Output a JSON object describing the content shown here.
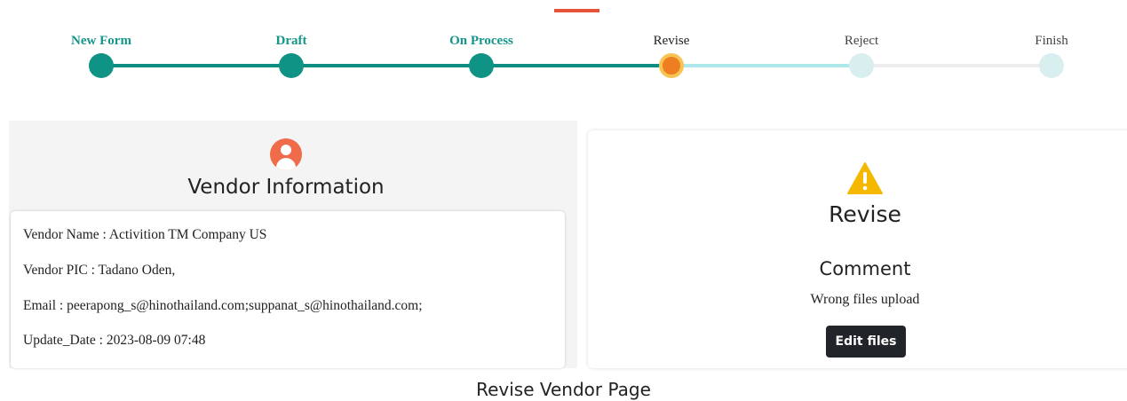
{
  "stepper": {
    "steps": [
      {
        "label": "New Form",
        "state": "done"
      },
      {
        "label": "Draft",
        "state": "done"
      },
      {
        "label": "On Process",
        "state": "done"
      },
      {
        "label": "Revise",
        "state": "current"
      },
      {
        "label": "Reject",
        "state": "todo"
      },
      {
        "label": "Finish",
        "state": "todo"
      }
    ]
  },
  "vendor": {
    "icon": "user-circle-icon",
    "title": "Vendor Information",
    "name_line": "Vendor Name : Activition TM Company US",
    "pic_line": "Vendor PIC : Tadano Oden,",
    "email_line": "Email : peerapong_s@hinothailand.com;suppanat_s@hinothailand.com;",
    "update_line": "Update_Date : 2023-08-09 07:48"
  },
  "revise": {
    "icon": "warning-icon",
    "title": "Revise",
    "comment_title": "Comment",
    "comment_text": "Wrong files upload",
    "edit_button": "Edit files"
  },
  "caption": "Revise Vendor Page",
  "colors": {
    "accent": "#e5533b",
    "done": "#0e9384",
    "current": "#ef7d21",
    "current_ring": "#f6c453",
    "warning": "#f5b800"
  }
}
